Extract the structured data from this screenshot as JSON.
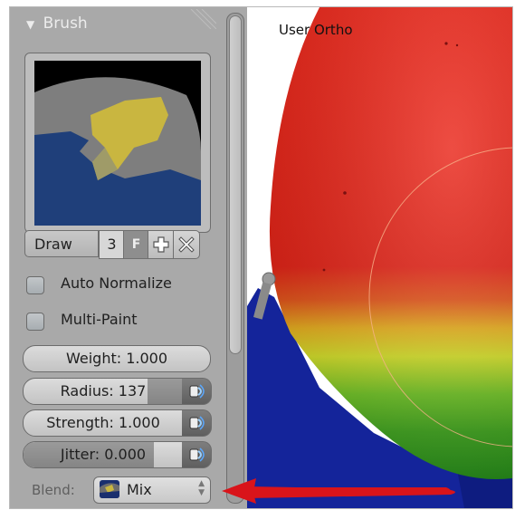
{
  "panel": {
    "title": "Brush",
    "brush": {
      "name": "Draw",
      "users": "3",
      "fake_user": "F"
    },
    "options": [
      {
        "label": "Auto Normalize",
        "checked": false
      },
      {
        "label": "Multi-Paint",
        "checked": false
      }
    ],
    "sliders": {
      "weight": {
        "label": "Weight: 1.000",
        "fill_fraction": 0.0
      },
      "radius": {
        "label": "Radius: 137",
        "fill_fraction": 0.22
      },
      "strength": {
        "label": "Strength: 1.000",
        "fill_fraction": 0.0
      },
      "jitter": {
        "label": "Jitter: 0.000",
        "fill_fraction": 0.82
      }
    },
    "blend": {
      "label": "Blend:",
      "value": "Mix"
    }
  },
  "viewport": {
    "view_label": "User Ortho"
  },
  "colors": {
    "panel_bg": "#a9a9a9",
    "mesh_red": "#e8261a",
    "mesh_yellow": "#d9e02a",
    "mesh_green": "#3fa21e",
    "mesh_blue": "#14249a",
    "arrow_red": "#d9141a"
  },
  "icons": {
    "add": "plus-icon",
    "remove": "x-icon",
    "pressure": "pressure-icon",
    "collapse": "disclosure-triangle-icon"
  }
}
